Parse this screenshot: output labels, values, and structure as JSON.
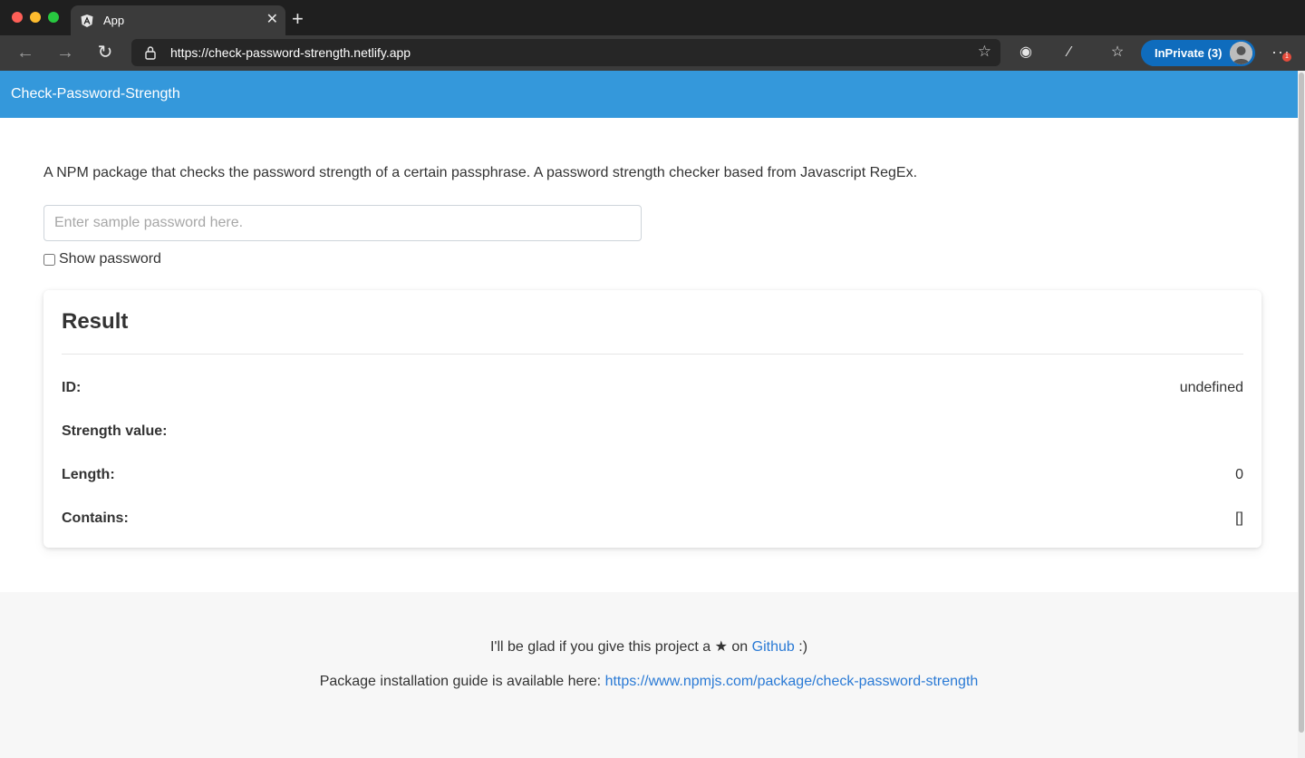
{
  "browser": {
    "tab_title": "App",
    "tab_close": "✕",
    "new_tab": "+",
    "url": "https://check-password-strength.netlify.app",
    "inprivate_label": "InPrivate (3)",
    "notification_badge": "1"
  },
  "navbar": {
    "brand": "Check-Password-Strength"
  },
  "intro": {
    "description": "A NPM package that checks the password strength of a certain passphrase. A password strength checker based from Javascript RegEx."
  },
  "password_input": {
    "placeholder": "Enter sample password here.",
    "value": ""
  },
  "show_password": {
    "label": "Show password",
    "checked": false
  },
  "result": {
    "title": "Result",
    "rows": [
      {
        "label": "ID:",
        "value": "undefined"
      },
      {
        "label": "Strength value:",
        "value": ""
      },
      {
        "label": "Length:",
        "value": "0"
      },
      {
        "label": "Contains:",
        "value": "[]"
      }
    ]
  },
  "footer": {
    "line1_prefix": "I'll be glad if you give this project a",
    "line1_star": "★",
    "line1_on": "on",
    "line1_link": "Github",
    "line1_suffix": ":)",
    "line2_prefix": "Package installation guide is available here:",
    "line2_link": "https://www.npmjs.com/package/check-password-strength"
  },
  "colors": {
    "navbar": "#3498db",
    "link": "#2a7ad5",
    "inprivate": "#0f6cbd"
  }
}
